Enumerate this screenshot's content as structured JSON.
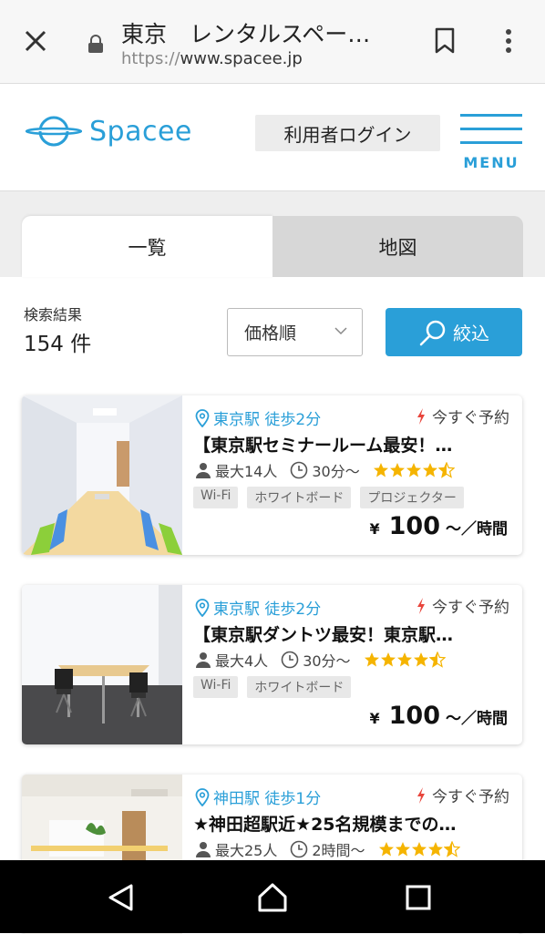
{
  "browser": {
    "title": "東京　レンタルスペー…",
    "url_prefix": "https://",
    "url_host": "www.spacee.jp"
  },
  "header": {
    "logo_text": "Spacee",
    "login_label": "利用者ログイン",
    "menu_label": "MENU"
  },
  "tabs": [
    {
      "label": "一覧",
      "active": true
    },
    {
      "label": "地図",
      "active": false
    }
  ],
  "results": {
    "label": "検索結果",
    "count": "154 件"
  },
  "sort": {
    "selected": "価格順"
  },
  "filter": {
    "label": "絞込"
  },
  "listings": [
    {
      "location": "東京駅 徒歩2分",
      "instant": "今すぐ予約",
      "title": "【東京駅セミナールーム最安！…",
      "capacity": "最大14人",
      "min_time": "30分〜",
      "rating": 4.5,
      "tags": [
        "Wi-Fi",
        "ホワイトボード",
        "プロジェクター"
      ],
      "price_symbol": "¥",
      "price": "100",
      "price_unit": "〜／時間"
    },
    {
      "location": "東京駅 徒歩2分",
      "instant": "今すぐ予約",
      "title": "【東京駅ダントツ最安！東京駅…",
      "capacity": "最大4人",
      "min_time": "30分〜",
      "rating": 4.5,
      "tags": [
        "Wi-Fi",
        "ホワイトボード"
      ],
      "price_symbol": "¥",
      "price": "100",
      "price_unit": "〜／時間"
    },
    {
      "location": "神田駅 徒歩1分",
      "instant": "今すぐ予約",
      "title": "★神田超駅近★25名規模までの…",
      "capacity": "最大25人",
      "min_time": "2時間〜",
      "rating": 4.5
    }
  ],
  "colors": {
    "accent": "#2a9fd8",
    "star": "#f5b400",
    "bolt": "#e8453c"
  }
}
